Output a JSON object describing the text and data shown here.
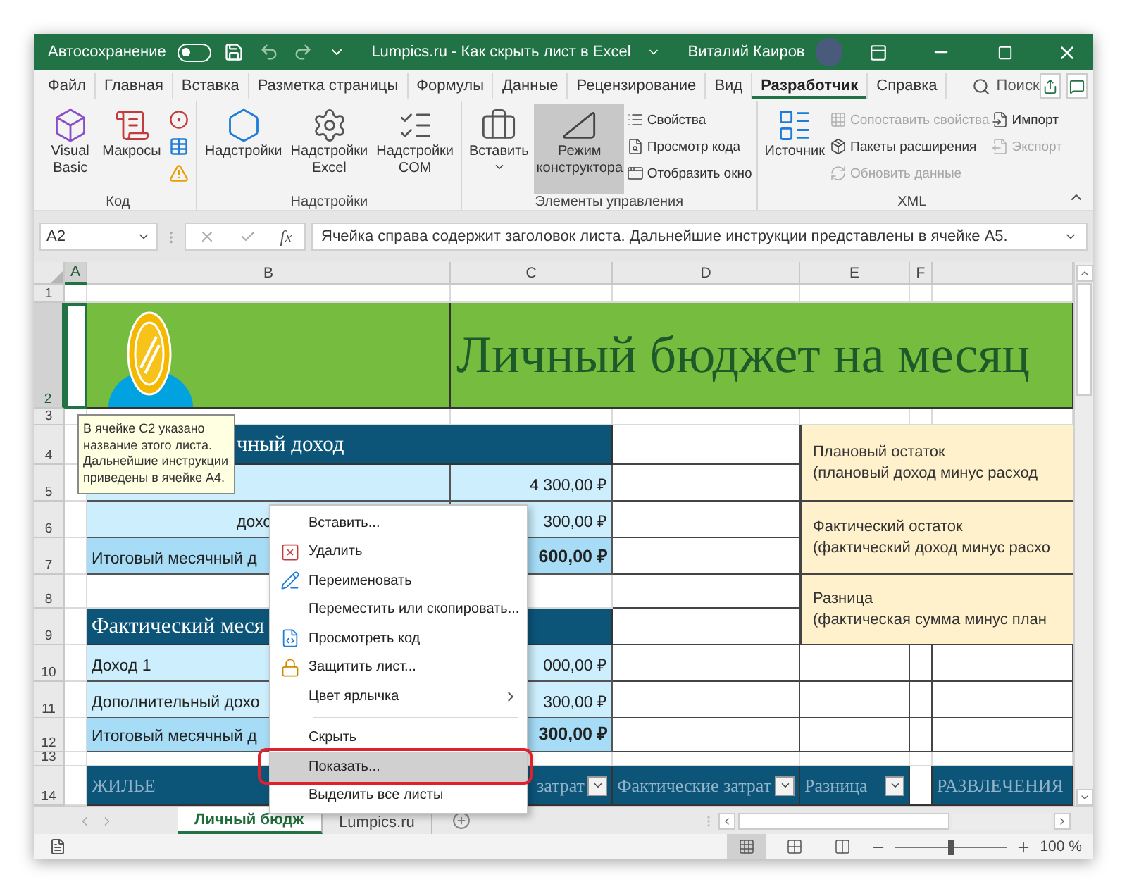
{
  "title_bar": {
    "autosave_label": "Автосохранение",
    "autosave_on": false,
    "document_title": "Lumpics.ru - Как скрыть лист в Excel",
    "user_name": "Виталий Каиров"
  },
  "ribbon_tabs": [
    {
      "label": "Файл",
      "selected": false
    },
    {
      "label": "Главная",
      "selected": false
    },
    {
      "label": "Вставка",
      "selected": false
    },
    {
      "label": "Разметка страницы",
      "selected": false
    },
    {
      "label": "Формулы",
      "selected": false
    },
    {
      "label": "Данные",
      "selected": false
    },
    {
      "label": "Рецензирование",
      "selected": false
    },
    {
      "label": "Вид",
      "selected": false
    },
    {
      "label": "Разработчик",
      "selected": true
    },
    {
      "label": "Справка",
      "selected": false
    }
  ],
  "search": {
    "placeholder": "Поиск"
  },
  "ribbon_groups": [
    {
      "label": "Код",
      "items": [
        {
          "kind": "large",
          "label": "Visual Basic"
        },
        {
          "kind": "large",
          "label": "Макросы"
        },
        {
          "kind": "icons"
        }
      ]
    },
    {
      "label": "Надстройки",
      "items": [
        {
          "kind": "large",
          "label": "Надстройки"
        },
        {
          "kind": "large",
          "label": "Надстройки Excel"
        },
        {
          "kind": "large",
          "label": "Надстройки COM"
        }
      ]
    },
    {
      "label": "Элементы управления",
      "items": [
        {
          "kind": "large",
          "label": "Вставить",
          "dropdown": true
        },
        {
          "kind": "large",
          "label": "Режим конструктора",
          "pressed": true
        },
        {
          "kind": "small",
          "entries": [
            {
              "label": "Свойства",
              "disabled": false
            },
            {
              "label": "Просмотр кода",
              "disabled": false
            },
            {
              "label": "Отобразить окно",
              "disabled": false
            }
          ]
        }
      ]
    },
    {
      "label": "XML",
      "items": [
        {
          "kind": "large",
          "label": "Источник"
        },
        {
          "kind": "small",
          "entries": [
            {
              "label": "Сопоставить свойства",
              "disabled": true
            },
            {
              "label": "Пакеты расширения",
              "disabled": false
            },
            {
              "label": "Обновить данные",
              "disabled": true
            }
          ]
        },
        {
          "kind": "small",
          "entries": [
            {
              "label": "Импорт",
              "disabled": false
            },
            {
              "label": "Экспорт",
              "disabled": true
            }
          ]
        }
      ]
    }
  ],
  "formula_bar": {
    "name_box": "A2",
    "function_label": "fx",
    "formula": "Ячейка справа содержит заголовок листа. Дальнейшие инструкции представлены в ячейке A5."
  },
  "columns": [
    {
      "label": "A",
      "selected": true
    },
    {
      "label": "B",
      "selected": false
    },
    {
      "label": "C",
      "selected": false
    },
    {
      "label": "D",
      "selected": false
    },
    {
      "label": "E",
      "selected": false
    },
    {
      "label": "F",
      "selected": false
    }
  ],
  "rows": [
    {
      "label": "1",
      "selected": false
    },
    {
      "label": "2",
      "selected": true
    },
    {
      "label": "3",
      "selected": false
    },
    {
      "label": "4",
      "selected": false
    },
    {
      "label": "5",
      "selected": false
    },
    {
      "label": "6",
      "selected": false
    },
    {
      "label": "7",
      "selected": false
    },
    {
      "label": "8",
      "selected": false
    },
    {
      "label": "9",
      "selected": false
    },
    {
      "label": "10",
      "selected": false
    },
    {
      "label": "11",
      "selected": false
    },
    {
      "label": "12",
      "selected": false
    },
    {
      "label": "13",
      "selected": false
    },
    {
      "label": "14",
      "selected": false
    }
  ],
  "sheet_title": "Личный бюджет на месяц",
  "income_blocks": [
    {
      "header": "чный доход",
      "rows": [
        {
          "amount": "4 300,00 ₽",
          "total": false
        },
        {
          "label": "дохо",
          "amount": "300,00 ₽",
          "total": false
        },
        {
          "label": "Итоговый месячный д",
          "amount": "600,00 ₽",
          "total": true
        }
      ]
    },
    {
      "header": "Фактический меся",
      "rows": [
        {
          "label": "Доход 1",
          "amount": "000,00 ₽",
          "total": false
        },
        {
          "label": "Дополнительный дохо",
          "amount": "300,00 ₽",
          "total": false
        },
        {
          "label": "Итоговый месячный д",
          "amount": "300,00 ₽",
          "total": true
        }
      ]
    }
  ],
  "summary": [
    {
      "title": "Плановый остаток",
      "note": "(плановый доход минус расход"
    },
    {
      "title": "Фактический остаток",
      "note": "(фактический доход минус расхо"
    },
    {
      "title": "Разница",
      "note": "(фактическая сумма минус план"
    }
  ],
  "expense_header": [
    {
      "kind": "header",
      "text": "ЖИЛЬЕ",
      "filter": false
    },
    {
      "kind": "header",
      "text": "затрат",
      "filter": true
    },
    {
      "kind": "header",
      "text": "Фактические затрат",
      "filter": true
    },
    {
      "kind": "header",
      "text": "Разница",
      "filter": true
    },
    {
      "kind": "blank"
    },
    {
      "kind": "header",
      "text": "РАЗВЛЕЧЕНИЯ",
      "filter": false
    }
  ],
  "comment": "В ячейке C2 указано название этого листа. Дальнейшие инструкции приведены в ячейке A4.",
  "context_menu": [
    {
      "kind": "item",
      "label": "Вставить...",
      "selected": false
    },
    {
      "kind": "item",
      "label": "Удалить",
      "selected": false
    },
    {
      "kind": "item",
      "label": "Переименовать",
      "selected": false
    },
    {
      "kind": "item",
      "label": "Переместить или скопировать...",
      "selected": false
    },
    {
      "kind": "item",
      "label": "Просмотреть код",
      "selected": false
    },
    {
      "kind": "item",
      "label": "Защитить лист...",
      "selected": false
    },
    {
      "kind": "item",
      "label": "Цвет ярлычка",
      "selected": false,
      "submenu": true
    },
    {
      "kind": "divider"
    },
    {
      "kind": "item",
      "label": "Скрыть",
      "selected": false
    },
    {
      "kind": "item",
      "label": "Показать...",
      "selected": true
    },
    {
      "kind": "item",
      "label": "Выделить все листы",
      "selected": false
    }
  ],
  "sheet_tabs": [
    {
      "label": "Личный бюдж",
      "selected": true
    },
    {
      "label": "Lumpics.ru",
      "selected": false
    }
  ],
  "status_bar": {
    "views": [
      {
        "selected": true
      },
      {
        "selected": false
      },
      {
        "selected": false
      }
    ],
    "zoom": {
      "level": 0.5,
      "reading": "100 %"
    }
  }
}
